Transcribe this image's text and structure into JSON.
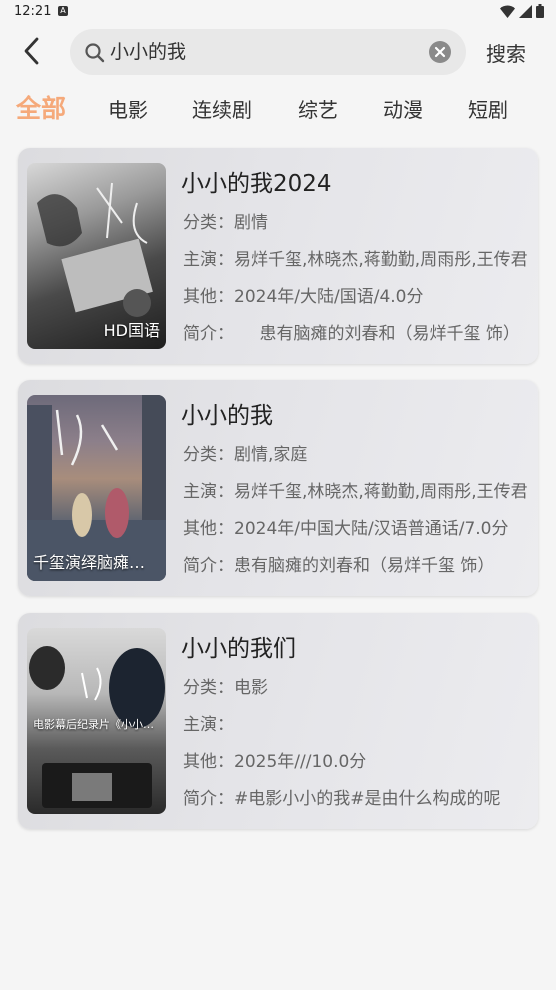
{
  "status_bar": {
    "time": "12:21",
    "notification_glyph": "A",
    "icons": [
      "wifi-icon",
      "signal-icon",
      "battery-icon"
    ]
  },
  "search": {
    "value": "小小的我",
    "button_label": "搜索"
  },
  "tabs": [
    {
      "label": "全部",
      "active": true
    },
    {
      "label": "电影",
      "active": false
    },
    {
      "label": "连续剧",
      "active": false
    },
    {
      "label": "综艺",
      "active": false
    },
    {
      "label": "动漫",
      "active": false
    },
    {
      "label": "短剧",
      "active": false
    }
  ],
  "results": [
    {
      "title": "小小的我2024",
      "poster_label": "HD国语",
      "category": "分类：剧情",
      "cast": "主演：易烊千玺,林晓杰,蒋勤勤,周雨彤,王传君",
      "other": "其他：2024年/大陆/国语/4.0分",
      "intro": "简介：　　患有脑瘫的刘春和（易烊千玺 饰）"
    },
    {
      "title": "小小的我",
      "poster_label": "千玺演绎脑瘫青年",
      "category": "分类：剧情,家庭",
      "cast": "主演：易烊千玺,林晓杰,蒋勤勤,周雨彤,王传君",
      "other": "其他：2024年/中国大陆/汉语普通话/7.0分",
      "intro": "简介：患有脑瘫的刘春和（易烊千玺 饰）"
    },
    {
      "title": "小小的我们",
      "poster_label": "电影幕后纪录片《小小的我们》",
      "category": "分类：电影",
      "cast": "主演：",
      "other": "其他：2025年///10.0分",
      "intro": "简介：#电影小小的我#是由什么构成的呢"
    }
  ],
  "colors": {
    "accent": "#f5a97a",
    "background": "#f5f5f5",
    "search_bg": "#e8e8e8"
  }
}
